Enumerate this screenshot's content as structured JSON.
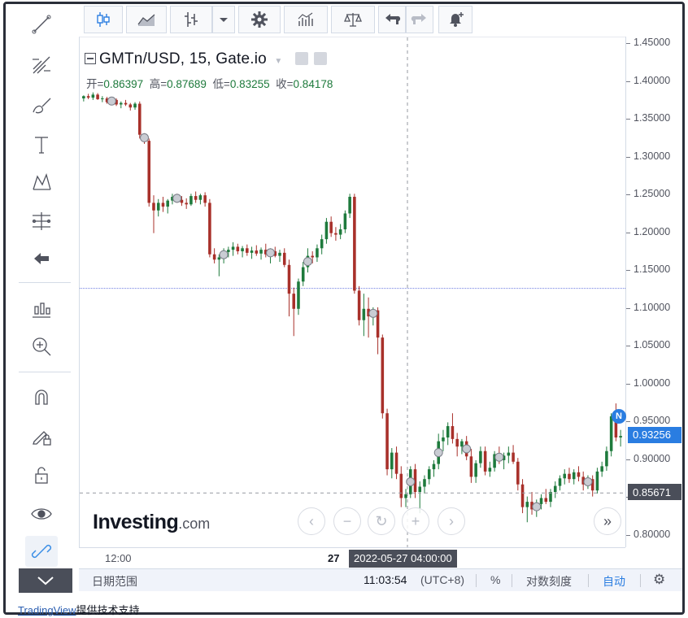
{
  "toolbar_left": {
    "tools": [
      "trend-line",
      "fib-retracement",
      "brush",
      "text",
      "pattern",
      "measure",
      "back-arrow",
      "chart-type-plus",
      "zoom-in",
      "magnet",
      "lock-pencil",
      "lock",
      "eye",
      "link"
    ]
  },
  "legend": {
    "symbol_text": "GMTn/USD, 15, Gate.io",
    "ohlc": [
      {
        "label": "开=",
        "value": "0.86397"
      },
      {
        "label": "高=",
        "value": "0.87689"
      },
      {
        "label": "低=",
        "value": "0.83255"
      },
      {
        "label": "收=",
        "value": "0.84178"
      }
    ]
  },
  "logo": {
    "brand": "Investing",
    "suffix": ".com"
  },
  "time_axis": {
    "labels": [
      {
        "text": "12:00",
        "x": 52
      },
      {
        "text": "27",
        "x": 314
      }
    ],
    "crosshair_label": "2022-05-27 04:00:00"
  },
  "price_axis": {
    "last_price": "0.93256",
    "crosshair_price": "0.85671",
    "n_badge": "N"
  },
  "bottom_bar": {
    "date_range": "日期范围",
    "clock": "11:03:54",
    "timezone": "(UTC+8)",
    "percent": "%",
    "log_scale": "对数刻度",
    "auto": "自动"
  },
  "footer": {
    "link_text": "TradingView",
    "suffix": "提供技术支持"
  },
  "colors": {
    "up": "#1e7a3c",
    "down": "#a8302a",
    "last_price_tag": "#2a7de1",
    "crosshair_tag": "#4a4e59",
    "horizontal_line": "#6b7ae0"
  },
  "chart_data": {
    "type": "candlestick",
    "title": "GMTn/USD, 15, Gate.io",
    "ylim": [
      0.775,
      1.455
    ],
    "y_ticks": [
      "1.45000",
      "1.40000",
      "1.35000",
      "1.30000",
      "1.25000",
      "1.20000",
      "1.15000",
      "1.10000",
      "1.05000",
      "1.00000",
      "0.95000",
      "0.90000",
      "0.85000",
      "0.80000"
    ],
    "horizontal_line": 1.127,
    "crosshair_y": 0.85671,
    "candles": [
      [
        1.378,
        1.382,
        1.374,
        1.381
      ],
      [
        1.381,
        1.384,
        1.377,
        1.379
      ],
      [
        1.379,
        1.386,
        1.376,
        1.383
      ],
      [
        1.383,
        1.385,
        1.376,
        1.377
      ],
      [
        1.377,
        1.381,
        1.373,
        1.378
      ],
      [
        1.378,
        1.38,
        1.371,
        1.373
      ],
      [
        1.373,
        1.378,
        1.37,
        1.376
      ],
      [
        1.376,
        1.378,
        1.368,
        1.37
      ],
      [
        1.37,
        1.374,
        1.365,
        1.372
      ],
      [
        1.372,
        1.376,
        1.368,
        1.37
      ],
      [
        1.37,
        1.372,
        1.362,
        1.366
      ],
      [
        1.366,
        1.373,
        1.363,
        1.371
      ],
      [
        1.371,
        1.374,
        1.325,
        1.33
      ],
      [
        1.33,
        1.332,
        1.318,
        1.322
      ],
      [
        1.322,
        1.325,
        1.235,
        1.24
      ],
      [
        1.24,
        1.25,
        1.2,
        1.23
      ],
      [
        1.23,
        1.245,
        1.222,
        1.24
      ],
      [
        1.24,
        1.248,
        1.228,
        1.235
      ],
      [
        1.235,
        1.245,
        1.226,
        1.243
      ],
      [
        1.243,
        1.252,
        1.238,
        1.248
      ],
      [
        1.248,
        1.252,
        1.24,
        1.244
      ],
      [
        1.244,
        1.249,
        1.236,
        1.24
      ],
      [
        1.24,
        1.246,
        1.232,
        1.238
      ],
      [
        1.238,
        1.252,
        1.236,
        1.249
      ],
      [
        1.249,
        1.255,
        1.24,
        1.244
      ],
      [
        1.244,
        1.252,
        1.238,
        1.25
      ],
      [
        1.25,
        1.254,
        1.235,
        1.24
      ],
      [
        1.24,
        1.245,
        1.168,
        1.172
      ],
      [
        1.172,
        1.18,
        1.16,
        1.165
      ],
      [
        1.165,
        1.172,
        1.143,
        1.168
      ],
      [
        1.168,
        1.18,
        1.16,
        1.175
      ],
      [
        1.175,
        1.182,
        1.168,
        1.178
      ],
      [
        1.178,
        1.188,
        1.17,
        1.182
      ],
      [
        1.182,
        1.186,
        1.172,
        1.176
      ],
      [
        1.176,
        1.183,
        1.168,
        1.18
      ],
      [
        1.18,
        1.185,
        1.17,
        1.174
      ],
      [
        1.174,
        1.182,
        1.166,
        1.177
      ],
      [
        1.177,
        1.184,
        1.17,
        1.173
      ],
      [
        1.173,
        1.181,
        1.165,
        1.178
      ],
      [
        1.178,
        1.186,
        1.168,
        1.172
      ],
      [
        1.172,
        1.18,
        1.16,
        1.176
      ],
      [
        1.176,
        1.182,
        1.168,
        1.17
      ],
      [
        1.17,
        1.178,
        1.162,
        1.174
      ],
      [
        1.174,
        1.18,
        1.155,
        1.158
      ],
      [
        1.158,
        1.165,
        1.09,
        1.12
      ],
      [
        1.12,
        1.128,
        1.064,
        1.1
      ],
      [
        1.1,
        1.14,
        1.092,
        1.136
      ],
      [
        1.136,
        1.162,
        1.13,
        1.155
      ],
      [
        1.155,
        1.18,
        1.148,
        1.17
      ],
      [
        1.17,
        1.176,
        1.16,
        1.168
      ],
      [
        1.168,
        1.185,
        1.162,
        1.18
      ],
      [
        1.18,
        1.198,
        1.172,
        1.192
      ],
      [
        1.192,
        1.22,
        1.186,
        1.215
      ],
      [
        1.215,
        1.222,
        1.195,
        1.2
      ],
      [
        1.2,
        1.208,
        1.19,
        1.198
      ],
      [
        1.198,
        1.212,
        1.192,
        1.205
      ],
      [
        1.205,
        1.23,
        1.2,
        1.226
      ],
      [
        1.226,
        1.252,
        1.22,
        1.248
      ],
      [
        1.248,
        1.252,
        1.12,
        1.124
      ],
      [
        1.124,
        1.13,
        1.078,
        1.085
      ],
      [
        1.085,
        1.12,
        1.064,
        1.1
      ],
      [
        1.1,
        1.115,
        1.062,
        1.09
      ],
      [
        1.09,
        1.102,
        1.078,
        1.098
      ],
      [
        1.098,
        1.102,
        1.04,
        1.062
      ],
      [
        1.062,
        1.066,
        0.955,
        0.962
      ],
      [
        0.962,
        0.968,
        0.88,
        0.888
      ],
      [
        0.888,
        0.916,
        0.876,
        0.91
      ],
      [
        0.91,
        0.918,
        0.875,
        0.882
      ],
      [
        0.882,
        0.892,
        0.838,
        0.85
      ],
      [
        0.85,
        0.862,
        0.838,
        0.855
      ],
      [
        0.855,
        0.892,
        0.85,
        0.888
      ],
      [
        0.888,
        0.895,
        0.85,
        0.858
      ],
      [
        0.858,
        0.872,
        0.83,
        0.865
      ],
      [
        0.865,
        0.88,
        0.856,
        0.875
      ],
      [
        0.875,
        0.892,
        0.868,
        0.888
      ],
      [
        0.888,
        0.9,
        0.878,
        0.895
      ],
      [
        0.895,
        0.935,
        0.888,
        0.925
      ],
      [
        0.925,
        0.94,
        0.912,
        0.93
      ],
      [
        0.93,
        0.95,
        0.92,
        0.945
      ],
      [
        0.945,
        0.962,
        0.922,
        0.928
      ],
      [
        0.928,
        0.936,
        0.905,
        0.918
      ],
      [
        0.918,
        0.928,
        0.908,
        0.925
      ],
      [
        0.925,
        0.932,
        0.9,
        0.905
      ],
      [
        0.905,
        0.915,
        0.87,
        0.878
      ],
      [
        0.878,
        0.9,
        0.87,
        0.896
      ],
      [
        0.896,
        0.918,
        0.89,
        0.912
      ],
      [
        0.912,
        0.918,
        0.88,
        0.885
      ],
      [
        0.885,
        0.898,
        0.878,
        0.89
      ],
      [
        0.89,
        0.912,
        0.885,
        0.908
      ],
      [
        0.908,
        0.918,
        0.895,
        0.9
      ],
      [
        0.9,
        0.91,
        0.888,
        0.906
      ],
      [
        0.906,
        0.918,
        0.896,
        0.91
      ],
      [
        0.91,
        0.92,
        0.895,
        0.898
      ],
      [
        0.898,
        0.903,
        0.86,
        0.868
      ],
      [
        0.868,
        0.875,
        0.83,
        0.838
      ],
      [
        0.838,
        0.852,
        0.818,
        0.845
      ],
      [
        0.845,
        0.858,
        0.828,
        0.835
      ],
      [
        0.835,
        0.848,
        0.825,
        0.842
      ],
      [
        0.842,
        0.855,
        0.835,
        0.85
      ],
      [
        0.85,
        0.862,
        0.842,
        0.845
      ],
      [
        0.845,
        0.862,
        0.838,
        0.858
      ],
      [
        0.858,
        0.872,
        0.85,
        0.866
      ],
      [
        0.866,
        0.88,
        0.86,
        0.876
      ],
      [
        0.876,
        0.888,
        0.868,
        0.882
      ],
      [
        0.882,
        0.89,
        0.87,
        0.875
      ],
      [
        0.875,
        0.888,
        0.868,
        0.884
      ],
      [
        0.884,
        0.892,
        0.872,
        0.878
      ],
      [
        0.878,
        0.885,
        0.86,
        0.868
      ],
      [
        0.868,
        0.88,
        0.862,
        0.875
      ],
      [
        0.875,
        0.88,
        0.852,
        0.86
      ],
      [
        0.86,
        0.89,
        0.856,
        0.885
      ],
      [
        0.885,
        0.898,
        0.878,
        0.892
      ],
      [
        0.892,
        0.918,
        0.886,
        0.912
      ],
      [
        0.912,
        0.962,
        0.905,
        0.958
      ],
      [
        0.958,
        0.975,
        0.925,
        0.93
      ],
      [
        0.93,
        0.94,
        0.918,
        0.932
      ]
    ]
  }
}
